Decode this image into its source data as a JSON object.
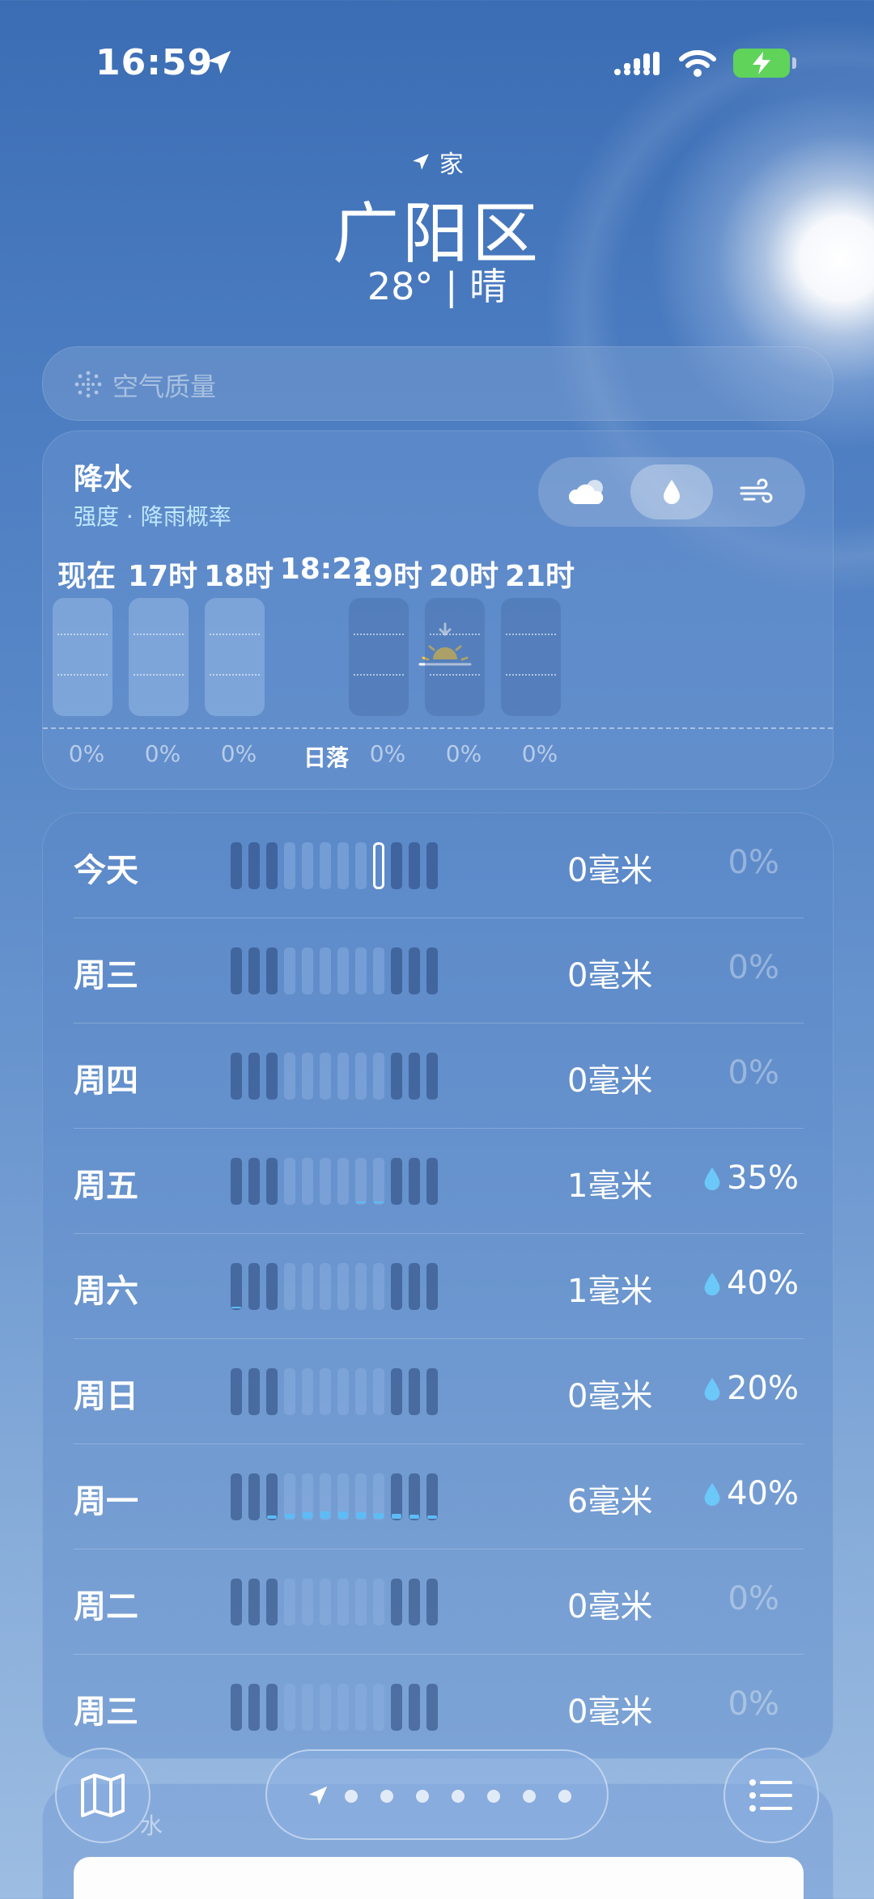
{
  "status_bar": {
    "time": "16:59"
  },
  "header": {
    "location_tag": "家",
    "city": "广阳区",
    "summary": "28° | 晴"
  },
  "air_quality": {
    "label": "空气质量"
  },
  "precipitation": {
    "title": "降水",
    "subtitle": "强度 · 降雨概率",
    "modes": [
      "cloud-icon",
      "droplet-icon",
      "wind-icon"
    ],
    "active_mode": "droplet-icon",
    "hours": [
      {
        "time": "现在",
        "chance": "0%"
      },
      {
        "time": "17时",
        "chance": "0%"
      },
      {
        "time": "18时",
        "chance": "0%"
      },
      {
        "time": "18:22",
        "chance": "日落"
      },
      {
        "time": "19时",
        "chance": "0%"
      },
      {
        "time": "20时",
        "chance": "0%"
      },
      {
        "time": "21时",
        "chance": "0%"
      }
    ]
  },
  "daily": [
    {
      "day": "今天",
      "amount": "0毫米",
      "chance": "0%"
    },
    {
      "day": "周三",
      "amount": "0毫米",
      "chance": "0%"
    },
    {
      "day": "周四",
      "amount": "0毫米",
      "chance": "0%"
    },
    {
      "day": "周五",
      "amount": "1毫米",
      "chance": "35%"
    },
    {
      "day": "周六",
      "amount": "1毫米",
      "chance": "40%"
    },
    {
      "day": "周日",
      "amount": "0毫米",
      "chance": "20%"
    },
    {
      "day": "周一",
      "amount": "6毫米",
      "chance": "40%"
    },
    {
      "day": "周二",
      "amount": "0毫米",
      "chance": "0%"
    },
    {
      "day": "周三",
      "amount": "0毫米",
      "chance": "0%"
    }
  ],
  "bottom": {
    "partial_label": "水",
    "page_count": 7
  }
}
